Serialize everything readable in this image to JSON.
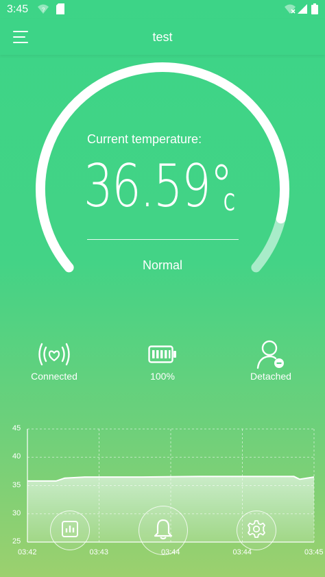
{
  "status_bar": {
    "time": "3:45"
  },
  "app_bar": {
    "title": "test"
  },
  "gauge": {
    "label": "Current temperature:",
    "value": "36.59°",
    "unit": "C",
    "status": "Normal",
    "fill_fraction": 0.9
  },
  "stats": [
    {
      "label": "Connected",
      "icon": "heart-signal-icon"
    },
    {
      "label": "100%",
      "icon": "battery-icon"
    },
    {
      "label": "Detached",
      "icon": "user-minus-icon"
    }
  ],
  "chart_data": {
    "type": "area",
    "title": "",
    "xlabel": "",
    "ylabel": "",
    "ylim": [
      25,
      45
    ],
    "yticks": [
      "45",
      "40",
      "35",
      "30",
      "25"
    ],
    "xticks": [
      "03:42",
      "03:43",
      "03:44",
      "03:44",
      "03:45"
    ],
    "grid": true,
    "series": [
      {
        "x": [
          0,
          0.1,
          0.13,
          0.2,
          0.4,
          0.6,
          0.8,
          0.93,
          0.95,
          1.0
        ],
        "values": [
          35.8,
          35.8,
          36.3,
          36.5,
          36.5,
          36.6,
          36.6,
          36.6,
          36.1,
          36.5
        ]
      }
    ]
  },
  "bottom_buttons": [
    {
      "icon": "report-icon"
    },
    {
      "icon": "bell-icon"
    },
    {
      "icon": "gear-icon"
    }
  ],
  "colors": {
    "background": "#3dd487",
    "gauge_track": "#ffffff",
    "gauge_remaining": "#a8ecc9"
  }
}
